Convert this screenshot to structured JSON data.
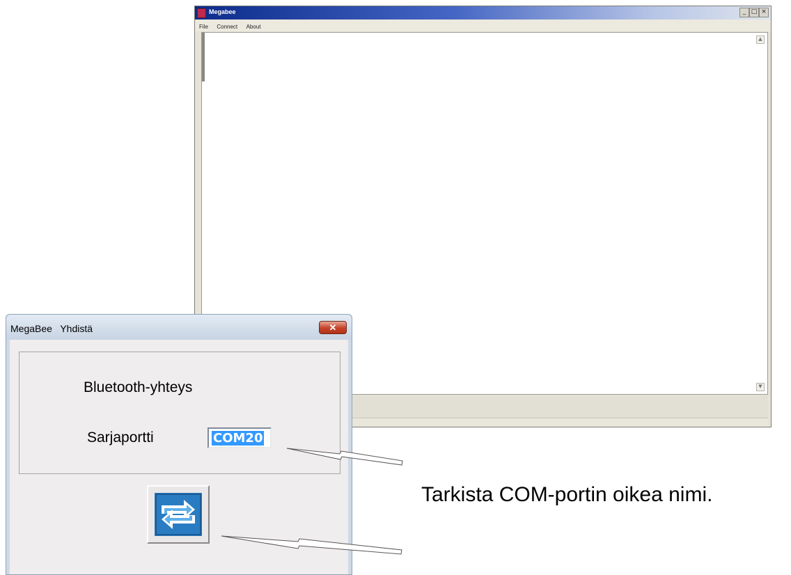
{
  "main_window": {
    "title": "Megabee",
    "controls": [
      "_",
      "□",
      "×"
    ],
    "menu": [
      "File",
      "Connect",
      "About"
    ],
    "scroll_up": "▲",
    "scroll_down": "▼"
  },
  "dialog": {
    "title": "MegaBee   Yhdistä",
    "close_glyph": "✕",
    "group_label": "Bluetooth-yhteys",
    "serial_port_label": "Sarjaportti",
    "serial_port_value": "COM20",
    "connect_icon": "swap-arrows-icon"
  },
  "annotation": {
    "text": "Tarkista COM-portin oikea nimi."
  },
  "colors": {
    "titlebar_active": "#0c2b8a",
    "selection": "#3399ff",
    "close_button": "#c4422a",
    "icon_blue": "#2a7cc2"
  }
}
